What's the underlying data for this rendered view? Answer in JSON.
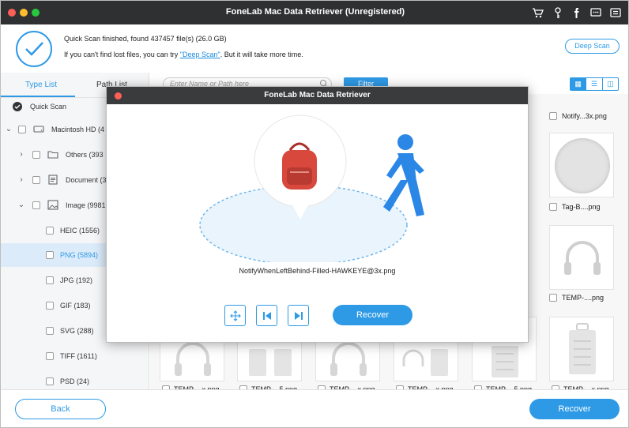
{
  "window": {
    "title": "FoneLab Mac Data Retriever (Unregistered)"
  },
  "titlebar_icons": [
    "cart-icon",
    "key-icon",
    "facebook-icon",
    "chat-icon",
    "menu-icon"
  ],
  "scan": {
    "status": "Quick Scan finished, found 437457 file(s) (26.0 GB)",
    "hint_prefix": "If you can't find lost files, you can try ",
    "hint_link": "\"Deep Scan\"",
    "hint_suffix": ". But it will take more time.",
    "deep_scan_label": "Deep Scan"
  },
  "sidebar": {
    "tabs": [
      {
        "label": "Type List"
      },
      {
        "label": "Path List"
      }
    ],
    "quick_scan_label": "Quick Scan",
    "items": [
      {
        "label": "Macintosh HD (4"
      },
      {
        "label": "Others (393"
      },
      {
        "label": "Document (3"
      },
      {
        "label": "Image (9981"
      },
      {
        "label": "HEIC (1556)"
      },
      {
        "label": "PNG (5894)"
      },
      {
        "label": "JPG (192)"
      },
      {
        "label": "GIF (183)"
      },
      {
        "label": "SVG (288)"
      },
      {
        "label": "TIFF (1611)"
      },
      {
        "label": "PSD (24)"
      }
    ]
  },
  "toolbar": {
    "search_placeholder": "Enter Name or Path here",
    "filter_label": "Filter"
  },
  "grid": {
    "labels": {
      "r1": "Notify...3x.png",
      "r2": "Tag-B....png",
      "r3": "TEMP-....png",
      "bottom": [
        "TEMP-...x.png",
        "TEMP-...5.png",
        "TEMP-...x.png",
        "TEMP-...x.png",
        "TEMP-...5.png",
        "TEMP-...x.png"
      ]
    }
  },
  "bottom": {
    "back_label": "Back",
    "recover_label": "Recover"
  },
  "modal": {
    "title": "FoneLab Mac Data Retriever",
    "filename": "NotifyWhenLeftBehind-Filled-HAWKEYE@3x.png",
    "recover_label": "Recover"
  },
  "colors": {
    "accent": "#2e9ae6",
    "titlebar": "#2f3032"
  }
}
